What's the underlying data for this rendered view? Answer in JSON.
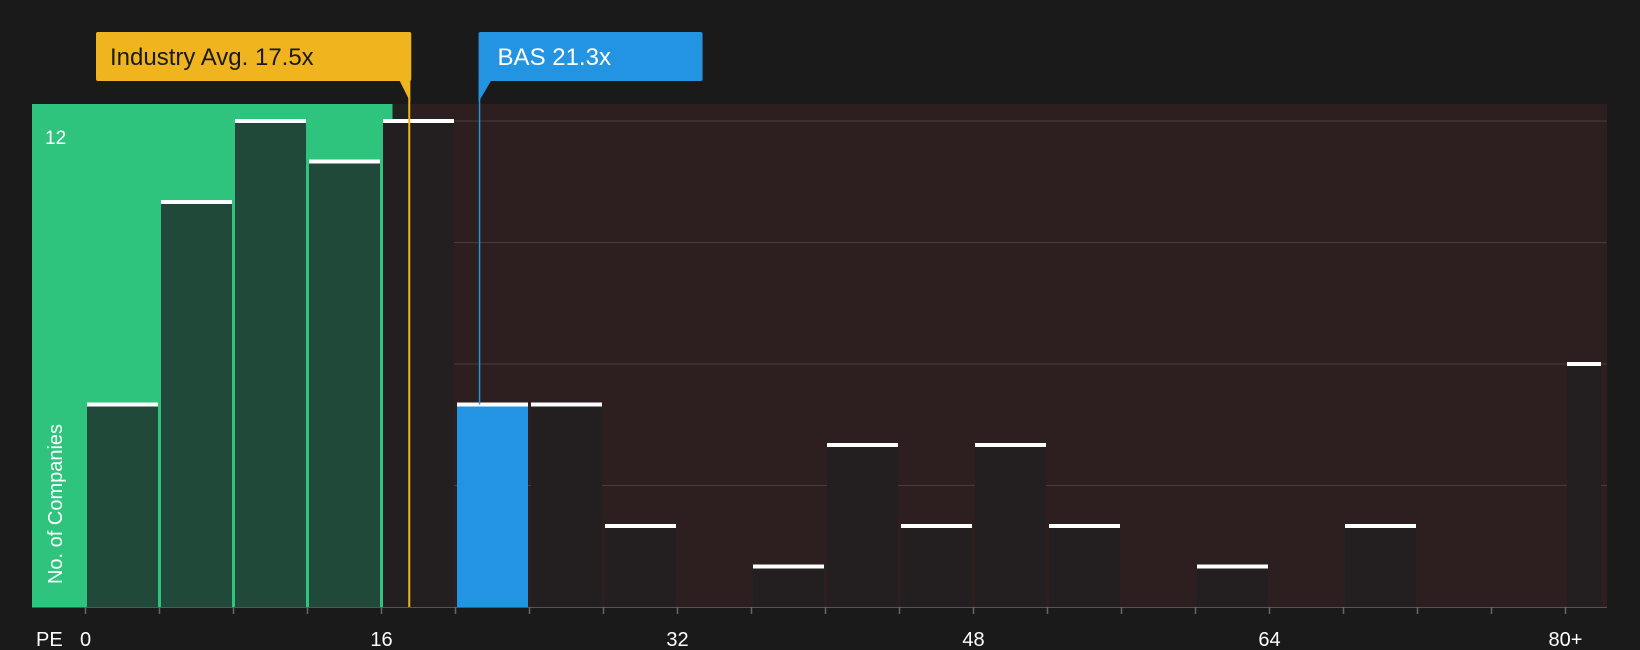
{
  "chart_data": {
    "type": "bar",
    "x_axis": {
      "label": "PE",
      "ticks": [
        "0",
        "16",
        "32",
        "48",
        "64",
        "80+"
      ],
      "range": [
        0,
        82
      ]
    },
    "y_axis": {
      "label": "No. of Companies",
      "max_label": "12",
      "range": [
        0,
        12
      ]
    },
    "bins": [
      {
        "start": 0,
        "end": 4,
        "value": 5
      },
      {
        "start": 4,
        "end": 8,
        "value": 10
      },
      {
        "start": 8,
        "end": 12,
        "value": 12
      },
      {
        "start": 12,
        "end": 16,
        "value": 11
      },
      {
        "start": 16,
        "end": 20,
        "value": 12
      },
      {
        "start": 20,
        "end": 24,
        "value": 5,
        "highlight": true
      },
      {
        "start": 24,
        "end": 28,
        "value": 5
      },
      {
        "start": 28,
        "end": 32,
        "value": 2
      },
      {
        "start": 32,
        "end": 36,
        "value": 0
      },
      {
        "start": 36,
        "end": 40,
        "value": 1
      },
      {
        "start": 40,
        "end": 44,
        "value": 4
      },
      {
        "start": 44,
        "end": 48,
        "value": 2
      },
      {
        "start": 48,
        "end": 52,
        "value": 4
      },
      {
        "start": 52,
        "end": 56,
        "value": 2
      },
      {
        "start": 56,
        "end": 60,
        "value": 0
      },
      {
        "start": 60,
        "end": 64,
        "value": 1
      },
      {
        "start": 64,
        "end": 68,
        "value": 0
      },
      {
        "start": 68,
        "end": 72,
        "value": 2
      },
      {
        "start": 72,
        "end": 76,
        "value": 0
      },
      {
        "start": 76,
        "end": 80,
        "value": 0
      },
      {
        "start": 80,
        "end": 82,
        "value": 6
      }
    ],
    "markers": {
      "industry_avg": {
        "label": "Industry Avg. 17.5x",
        "value": 17.5,
        "color": "#efb41e"
      },
      "company": {
        "label": "BAS 21.3x",
        "value": 21.3,
        "color": "#2394e1"
      }
    },
    "regions": {
      "undervalued_color": "#2ec47d",
      "overvalued_color": "#2d1e1f"
    },
    "grid": true
  }
}
